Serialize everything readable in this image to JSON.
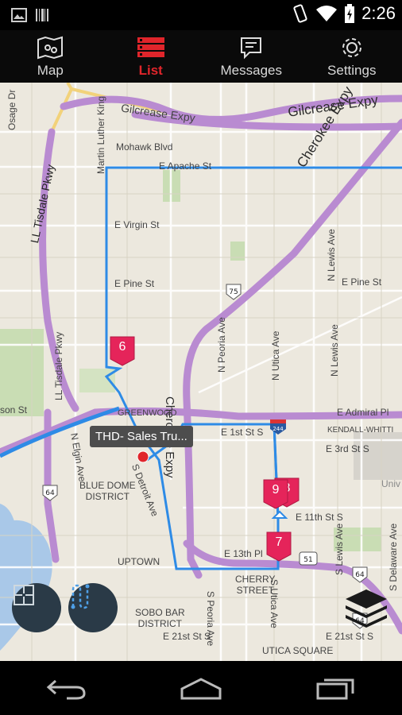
{
  "status_bar": {
    "time": "2:26",
    "left_icons": [
      "image-icon",
      "barcode-icon"
    ],
    "right_icons": [
      "vibrate-icon",
      "wifi-icon",
      "battery-icon"
    ]
  },
  "tabs": [
    {
      "label": "Map",
      "icon": "map-icon",
      "active": false
    },
    {
      "label": "List",
      "icon": "list-icon",
      "active": true
    },
    {
      "label": "Messages",
      "icon": "message-icon",
      "active": false
    },
    {
      "label": "Settings",
      "icon": "gear-icon",
      "active": false
    }
  ],
  "map": {
    "tooltip": "THD- Sales Tru...",
    "pins": [
      {
        "label": "6"
      },
      {
        "label": "9"
      },
      {
        "label": "8"
      },
      {
        "label": "7"
      }
    ],
    "shields": [
      "75",
      "244",
      "64",
      "51",
      "64",
      "64"
    ],
    "labels": {
      "gilcrease_1": "Gilcrease Expy",
      "gilcrease_2": "Gilcrease Expy",
      "cherokee_1": "Cherokee Expy",
      "cherokee_2": "Cherokee Expy",
      "tisdale_1": "LL Tisdale Pkwy",
      "tisdale_2": "LL Tisdale Pkwy",
      "mlk": "Martin Luther King",
      "osage": "Osage Dr",
      "mohawk": "Mohawk Blvd",
      "apache": "E Apache St",
      "virgin": "E Virgin St",
      "pine_w": "E Pine St",
      "pine_e": "E Pine St",
      "peoria_n": "N Peoria Ave",
      "utica_n": "N Utica Ave",
      "lewis_n1": "N Lewis Ave",
      "lewis_n2": "N Lewis Ave",
      "admiral": "E Admiral Pl",
      "kendall": "KENDALL-WHITTI",
      "first": "E 1st St S",
      "third": "E 3rd St S",
      "eleventh": "E 11th St S",
      "thirteenth": "E 13th Pl",
      "twentyfirst_w": "E 21st St S",
      "twentyfirst_e": "E 21st St S",
      "greenwood": "GREENWOOD",
      "detroit": "S Detroit Ave",
      "elgin": "N Elgin Ave",
      "bluedome": "BLUE DOME\nDISTRICT",
      "uptown": "UPTOWN",
      "cherry": "CHERRY\nSTREET",
      "sobo": "SOBO BAR\nDISTRICT",
      "utica_sq": "UTICA SQUARE",
      "peoria_s": "S Peoria Ave",
      "utica_s": "S Utica Ave",
      "lewis_s": "S Lewis Ave",
      "delaware": "S Delaware Ave",
      "univ": "Univ",
      "son": "son St"
    }
  },
  "controls": {
    "recenter_icon": "crosshair-icon",
    "route_icon": "route-icon",
    "layers_icon": "layers-icon"
  },
  "nav_bar": {
    "back_icon": "back-icon",
    "home_icon": "home-icon",
    "recents_icon": "recents-icon"
  },
  "colors": {
    "active_tab": "#e0252b",
    "route": "#2e8be6",
    "highway": "#b98bd1",
    "pin": "#e5245a"
  }
}
